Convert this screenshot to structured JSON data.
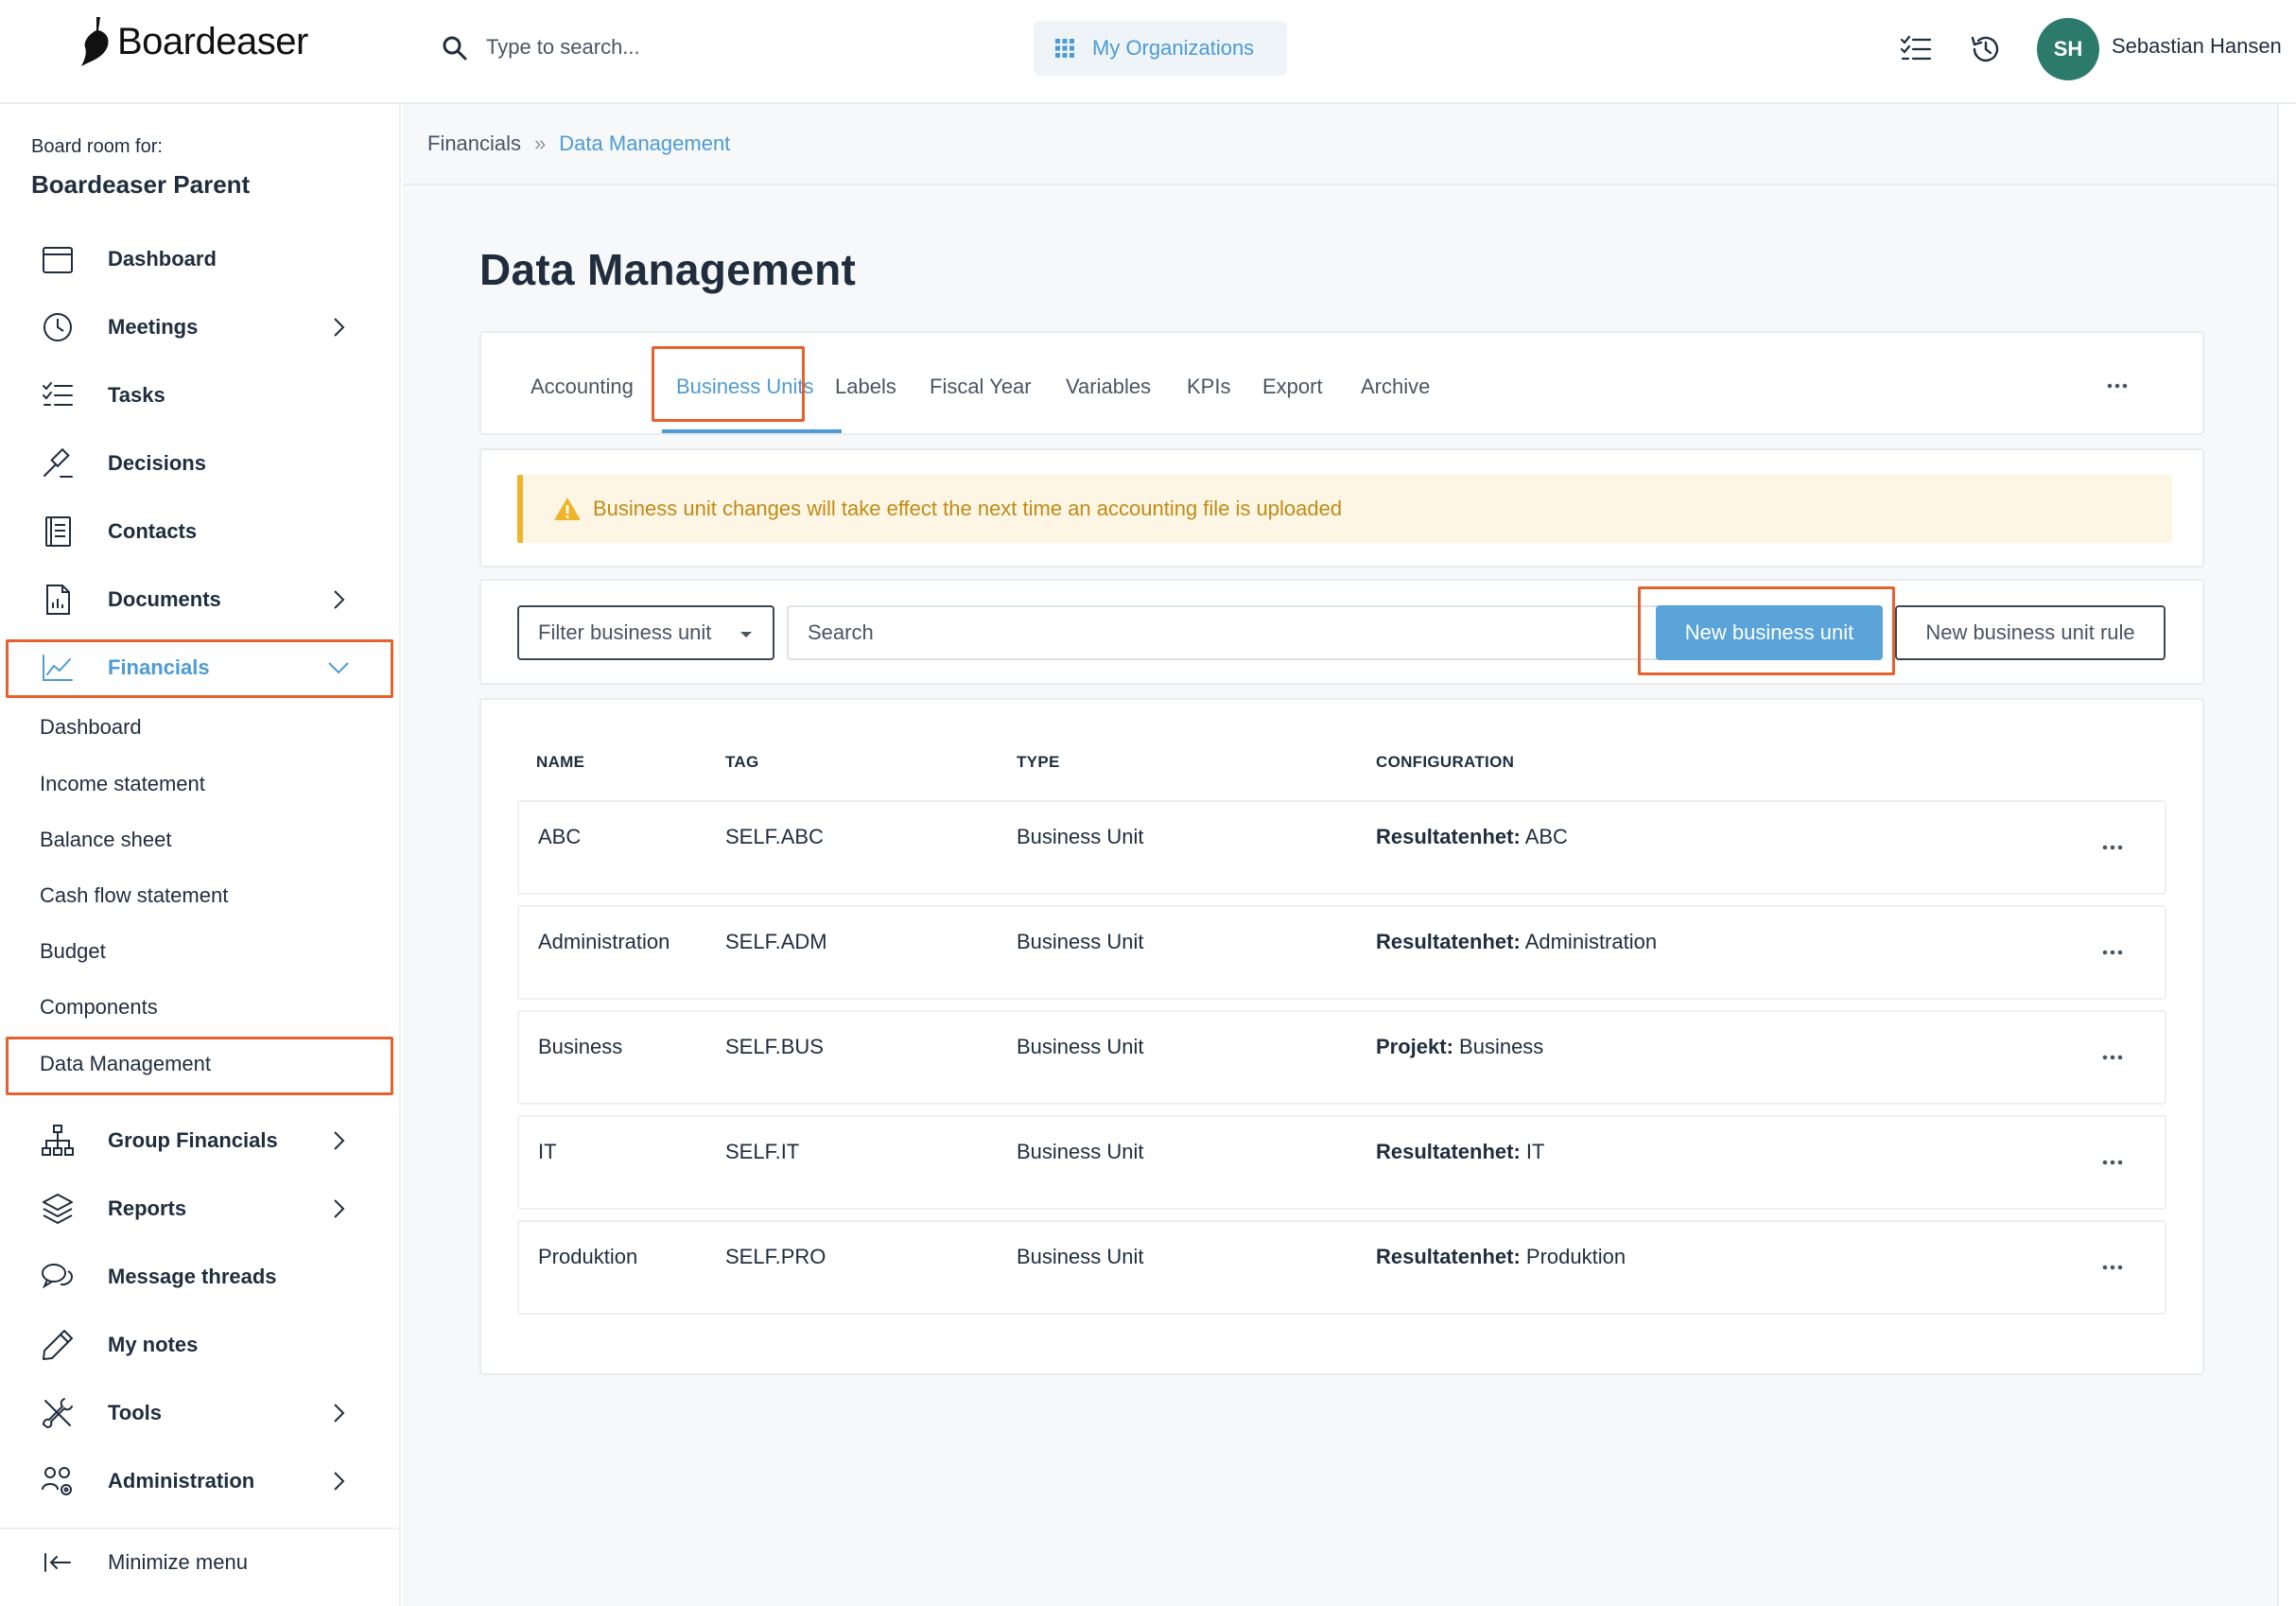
{
  "header": {
    "logo_text": "Boardeaser",
    "search_placeholder": "Type to search...",
    "org_button": "My Organizations",
    "user": {
      "initials": "SH",
      "name": "Sebastian Hansen"
    },
    "colors": {
      "accent": "#4c9bd6",
      "avatar": "#2c7a6b",
      "highlight": "#e8602c"
    }
  },
  "sidebar": {
    "board_room_label": "Board room for:",
    "board_room_name": "Boardeaser Parent",
    "items": [
      {
        "label": "Dashboard",
        "icon": "calendar-icon"
      },
      {
        "label": "Meetings",
        "icon": "clock-icon"
      },
      {
        "label": "Tasks",
        "icon": "checklist-icon"
      },
      {
        "label": "Decisions",
        "icon": "gavel-icon"
      },
      {
        "label": "Contacts",
        "icon": "address-book-icon"
      },
      {
        "label": "Documents",
        "icon": "document-icon"
      },
      {
        "label": "Financials",
        "icon": "chart-line-icon"
      },
      {
        "label": "Group Financials",
        "icon": "hierarchy-icon"
      },
      {
        "label": "Reports",
        "icon": "layers-icon"
      },
      {
        "label": "Message threads",
        "icon": "chat-icon"
      },
      {
        "label": "My notes",
        "icon": "pencil-icon"
      },
      {
        "label": "Tools",
        "icon": "tools-icon"
      },
      {
        "label": "Administration",
        "icon": "users-gear-icon"
      }
    ],
    "financials_sub": [
      "Dashboard",
      "Income statement",
      "Balance sheet",
      "Cash flow statement",
      "Budget",
      "Components",
      "Data Management"
    ],
    "minimize": "Minimize menu"
  },
  "breadcrumb": {
    "parent": "Financials",
    "separator": "»",
    "current": "Data Management"
  },
  "page": {
    "title": "Data Management"
  },
  "tabs": [
    "Accounting",
    "Business Units",
    "Labels",
    "Fiscal Year",
    "Variables",
    "KPIs",
    "Export",
    "Archive"
  ],
  "alert": {
    "text": "Business unit changes will take effect the next time an accounting file is uploaded"
  },
  "toolbar": {
    "filter_label": "Filter business unit",
    "search_placeholder": "Search",
    "new_unit": "New business unit",
    "new_rule": "New business unit rule"
  },
  "table": {
    "headers": [
      "NAME",
      "TAG",
      "TYPE",
      "CONFIGURATION"
    ],
    "rows": [
      {
        "name": "ABC",
        "tag": "SELF.ABC",
        "type": "Business Unit",
        "config_key": "Resultatenhet:",
        "config_value": " ABC"
      },
      {
        "name": "Administration",
        "tag": "SELF.ADM",
        "type": "Business Unit",
        "config_key": "Resultatenhet:",
        "config_value": " Administration"
      },
      {
        "name": "Business",
        "tag": "SELF.BUS",
        "type": "Business Unit",
        "config_key": "Projekt:",
        "config_value": " Business"
      },
      {
        "name": "IT",
        "tag": "SELF.IT",
        "type": "Business Unit",
        "config_key": "Resultatenhet:",
        "config_value": " IT"
      },
      {
        "name": "Produktion",
        "tag": "SELF.PRO",
        "type": "Business Unit",
        "config_key": "Resultatenhet:",
        "config_value": " Produktion"
      }
    ]
  }
}
